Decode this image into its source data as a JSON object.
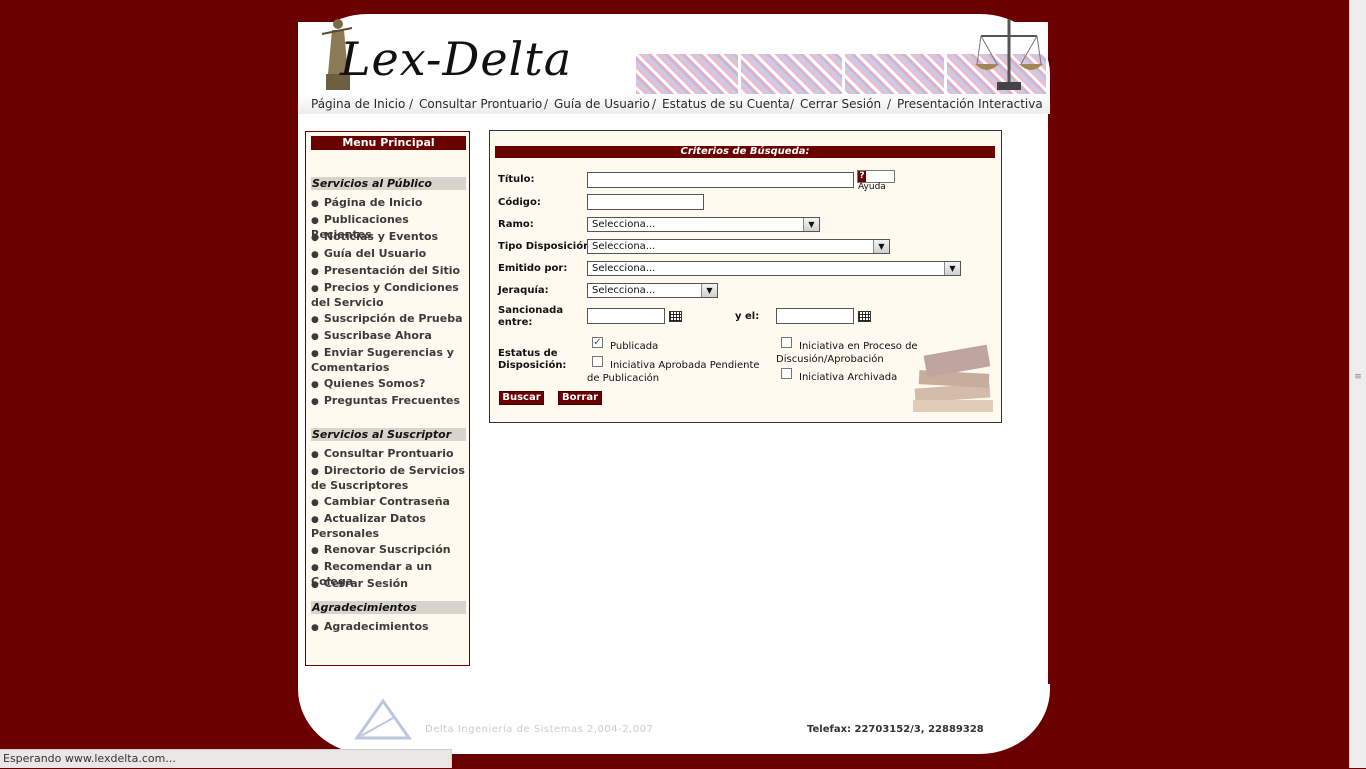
{
  "site": {
    "logo_text": "Lex-Delta"
  },
  "nav": {
    "items": [
      "Página de Inicio",
      "Consultar Prontuario",
      "Guía de Usuario",
      "Estatus de su Cuenta",
      "Cerrar Sesión",
      "Presentación Interactiva"
    ],
    "separator": "/"
  },
  "sidebar": {
    "title": "Menu Principal",
    "sections": [
      {
        "heading": "Servicios al Público",
        "items": [
          "Página de Inicio",
          "Publicaciones Recientes",
          "Noticias y Eventos",
          "Guía del Usuario",
          "Presentación del Sitio",
          "Precios y Condiciones del Servicio",
          "Suscripción de Prueba",
          "Suscribase Ahora",
          "Enviar Sugerencias y Comentarios",
          "Quienes Somos?",
          "Preguntas Frecuentes"
        ]
      },
      {
        "heading": "Servicios al Suscriptor",
        "items": [
          "Consultar Prontuario",
          "Directorio de Servicios de Suscriptores",
          "Cambiar Contraseña",
          "Actualizar Datos Personales",
          "Renovar Suscripción",
          "Recomendar a un Colega",
          "Cerrar Sesión"
        ]
      },
      {
        "heading": "Agradecimientos",
        "items": [
          "Agradecimientos"
        ]
      }
    ]
  },
  "search": {
    "title": "Criterios de Búsqueda:",
    "titulo_label": "Título:",
    "titulo_value": "",
    "ayuda_label": "Ayuda",
    "codigo_label": "Código:",
    "codigo_value": "",
    "ramo_label": "Ramo:",
    "ramo_value": "Selecciona...",
    "tipo_label": "Tipo Disposición:",
    "tipo_value": "Selecciona...",
    "emitido_label": "Emitido por:",
    "emitido_value": "Selecciona...",
    "jerarquia_label": "Jeraquía:",
    "jerarquia_value": "Selecciona...",
    "sancionada_label_1": "Sancionada",
    "sancionada_label_2": "entre:",
    "sancionada_from": "",
    "y_el_label": "y el:",
    "sancionada_to": "",
    "estatus_label_1": "Estatus de",
    "estatus_label_2": "Disposición:",
    "checkboxes": [
      {
        "label": "Publicada",
        "checked": true
      },
      {
        "label": "Iniciativa Aprobada Pendiente de Publicación",
        "checked": false
      },
      {
        "label": "Iniciativa en Proceso de Discusión/Aprobación",
        "checked": false
      },
      {
        "label": "Iniciativa Archivada",
        "checked": false
      }
    ],
    "buscar_label": "Buscar",
    "borrar_label": "Borrar"
  },
  "footer": {
    "company": "Delta Ingeniería de Sistemas 2,004-2,007",
    "phone": "Telefax: 22703152/3, 22889328"
  },
  "statusbar": {
    "text": "Esperando www.lexdelta.com..."
  },
  "colors": {
    "brand": "#6b0000",
    "panel_bg": "#fffaf0",
    "section_bg": "#d8d4cc"
  }
}
